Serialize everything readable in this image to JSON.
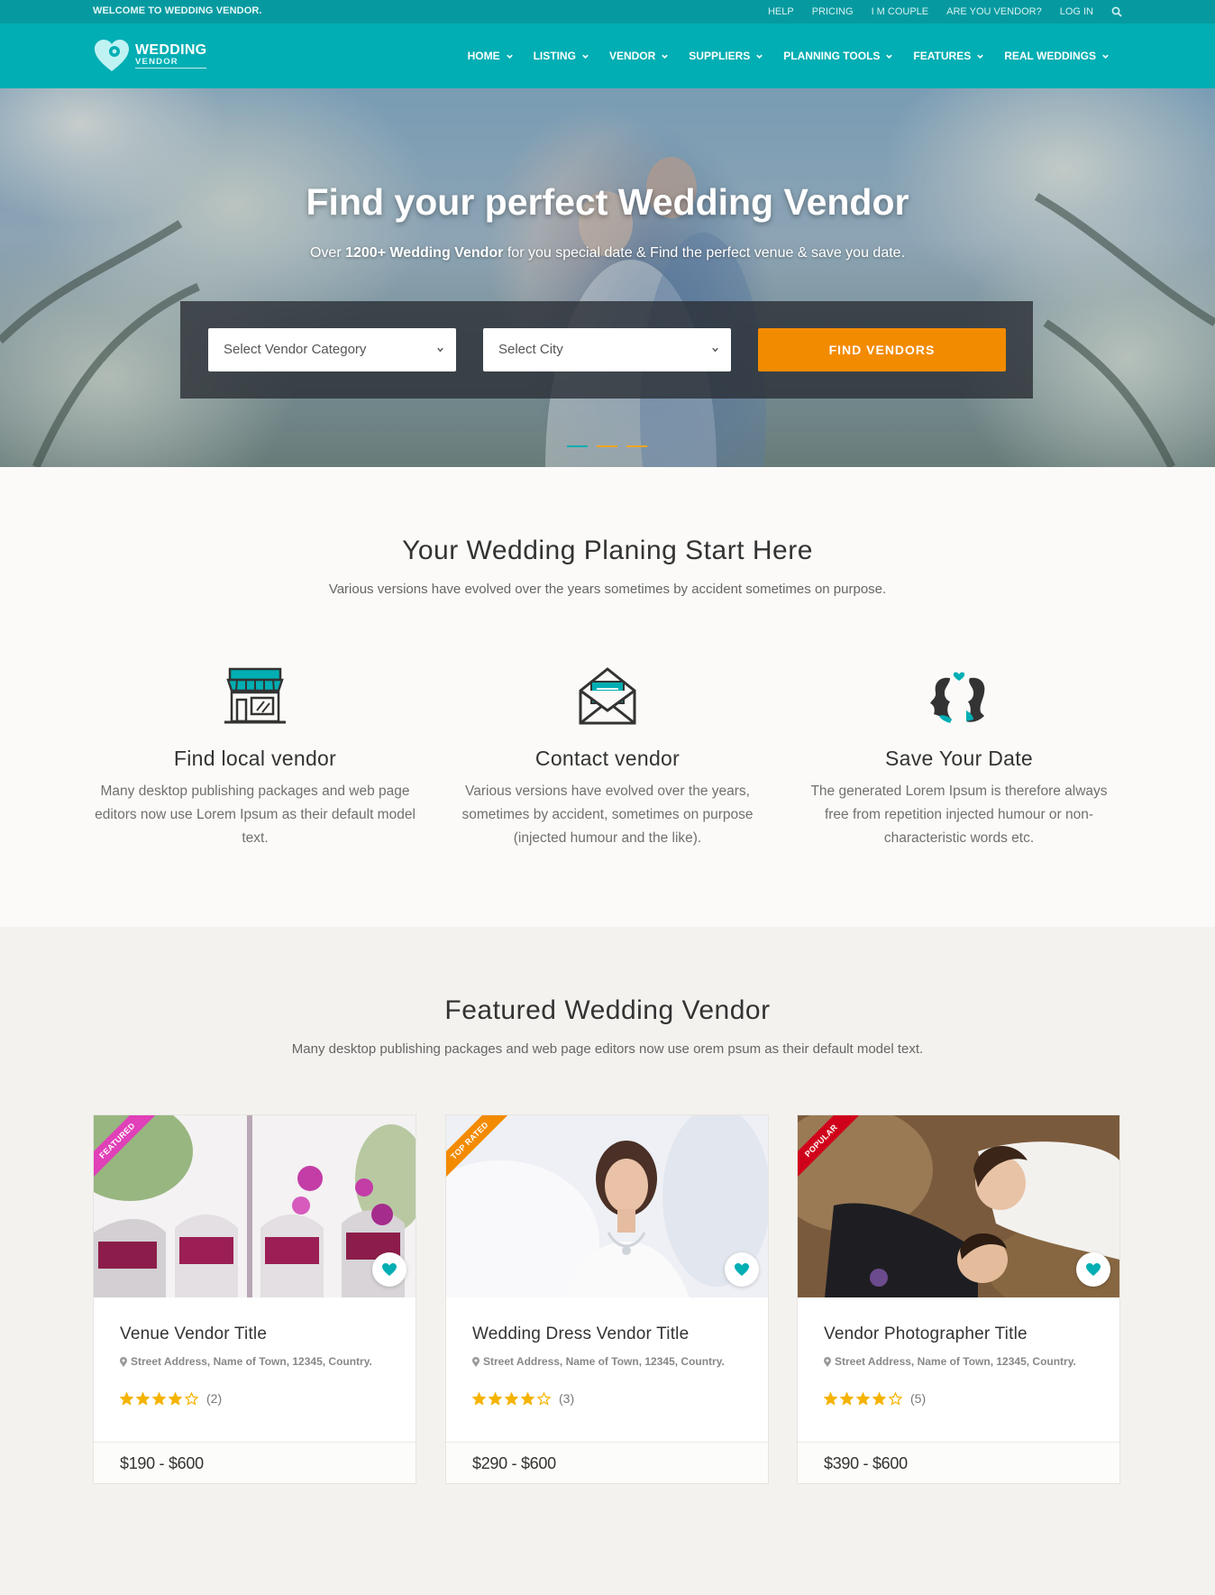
{
  "topbar": {
    "welcome": "WELCOME TO WEDDING VENDOR.",
    "links": [
      "HELP",
      "PRICING",
      "I M COUPLE",
      "ARE YOU VENDOR?",
      "LOG IN"
    ]
  },
  "logo": {
    "line1": "WEDDING",
    "line2": "VENDOR"
  },
  "nav": [
    "HOME",
    "LISTING",
    "VENDOR",
    "SUPPLIERS",
    "PLANNING TOOLS",
    "FEATURES",
    "REAL WEDDINGS"
  ],
  "hero": {
    "title": "Find your perfect Wedding Vendor",
    "sub_prefix": "Over ",
    "sub_bold": "1200+ Wedding Vendor",
    "sub_suffix": " for you special date & Find the perfect venue & save you date.",
    "category_select": "Select Vendor Category",
    "city_select": "Select City",
    "find_button": "FIND VENDORS"
  },
  "planning": {
    "title": "Your Wedding Planing Start Here",
    "subtitle": "Various versions have evolved over the years sometimes by accident sometimes on purpose.",
    "features": [
      {
        "icon": "shop-icon",
        "title": "Find local vendor",
        "text": "Many desktop publishing packages and web page editors now use Lorem Ipsum as their default model text."
      },
      {
        "icon": "envelope-icon",
        "title": "Contact vendor",
        "text": "Various versions have evolved over the years, sometimes by accident, sometimes on purpose (injected humour and the like)."
      },
      {
        "icon": "couple-icon",
        "title": "Save Your Date",
        "text": "The generated Lorem Ipsum is therefore always free from repetition injected humour or non-characteristic words etc."
      }
    ]
  },
  "featured": {
    "title": "Featured Wedding Vendor",
    "subtitle": "Many desktop publishing packages and web page editors now use orem psum as their default model text.",
    "cards": [
      {
        "ribbon": "FEATURED",
        "ribbon_color": "#e040b8",
        "title": "Venue Vendor Title",
        "address": "Street Address, Name of Town, 12345, Country.",
        "rating": 4,
        "reviews": "(2)",
        "price": "$190 - $600"
      },
      {
        "ribbon": "TOP RATED",
        "ribbon_color": "#f38b00",
        "title": "Wedding Dress Vendor Title",
        "address": "Street Address, Name of Town, 12345, Country.",
        "rating": 4,
        "reviews": "(3)",
        "price": "$290 - $600"
      },
      {
        "ribbon": "POPULAR",
        "ribbon_color": "#d0021b",
        "title": "Vendor Photographer Title",
        "address": "Street Address, Name of Town, 12345, Country.",
        "rating": 4,
        "reviews": "(5)",
        "price": "$390 - $600"
      }
    ]
  },
  "colors": {
    "teal": "#00aeb3",
    "orange": "#f38b00",
    "star": "#f5b301"
  }
}
